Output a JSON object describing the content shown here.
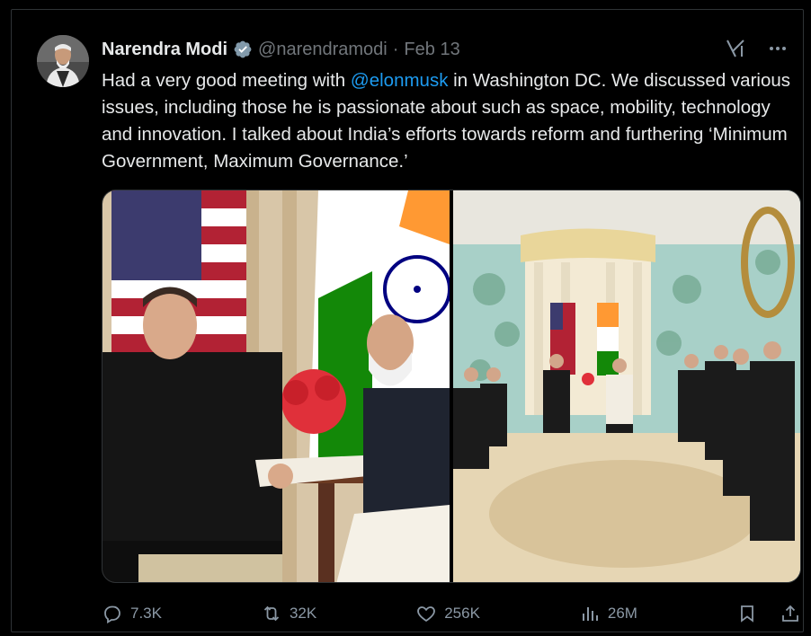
{
  "author": {
    "name": "Narendra Modi",
    "handle": "@narendramodi",
    "separator": "·",
    "date": "Feb 13"
  },
  "tweet": {
    "text_before": "Had a very good meeting with ",
    "mention": "@elonmusk",
    "text_after": " in Washington DC. We discussed various issues, including those he is passionate about such as space, mobility, technology and innovation. I talked about India’s efforts towards reform and furthering ‘Minimum Government, Maximum Governance.’"
  },
  "actions": {
    "replies": "7.3K",
    "reposts": "32K",
    "likes": "256K",
    "views": "26M"
  },
  "icons": {
    "verified": "verified-badge-icon",
    "grok": "grok-icon",
    "more": "more-icon",
    "reply": "reply-icon",
    "repost": "repost-icon",
    "like": "like-icon",
    "views": "views-icon",
    "bookmark": "bookmark-icon",
    "share": "share-icon"
  },
  "colors": {
    "background": "#000000",
    "text": "#e7e9ea",
    "secondary": "#71767b",
    "accent": "#1d9bf0"
  }
}
